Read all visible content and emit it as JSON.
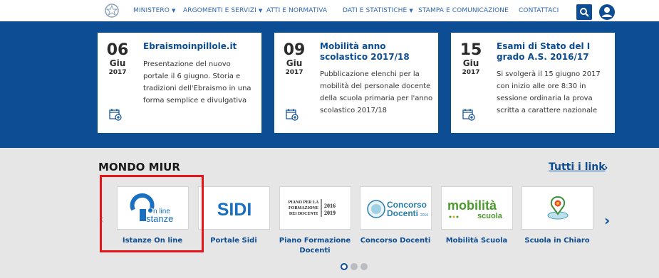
{
  "nav": {
    "items": [
      {
        "label": "MINISTERO",
        "dropdown": true
      },
      {
        "label": "ARGOMENTI E SERVIZI",
        "dropdown": true
      },
      {
        "label": "ATTI E NORMATIVA",
        "dropdown": false
      },
      {
        "label": "DATI E STATISTICHE",
        "dropdown": true
      },
      {
        "label": "STAMPA E COMUNICAZIONE",
        "dropdown": false
      },
      {
        "label": "CONTATTACI",
        "dropdown": false
      }
    ],
    "caret": "▼"
  },
  "news": [
    {
      "day": "06",
      "month": "Giu",
      "year": "2017",
      "title": "Ebraismoinpillole.it",
      "text": "Presentazione del nuovo portale il 6 giugno. Storia e tradizioni dell'Ebraismo in una forma semplice e divulgativa"
    },
    {
      "day": "09",
      "month": "Giu",
      "year": "2017",
      "title": "Mobilità anno scolastico 2017/18",
      "text": "Pubblicazione elenchi per la mobilità del personale docente della scuola primaria per l'anno scolastico 2017/18"
    },
    {
      "day": "15",
      "month": "Giu",
      "year": "2017",
      "title": "Esami di Stato del I grado A.S. 2016/17",
      "text": "Si svolgerà il 15 giugno 2017 con inizio alle ore 8:30 in sessione ordinaria la prova scritta a carattere nazionale"
    }
  ],
  "mondo": {
    "title": "MONDO MIUR",
    "all_links": "Tutti i link",
    "all_links_chevron": "›",
    "prev": "‹",
    "next": "›",
    "tiles": [
      {
        "label": "Istanze On line",
        "logo_line1": "n line",
        "logo_line2": "stanze"
      },
      {
        "label": "Portale Sidi",
        "logo": "SIDI"
      },
      {
        "label": "Piano Formazione Docenti",
        "logo_lines": [
          "PIANO PER LA",
          "FORMAZIONE",
          "DEI DOCENTI"
        ],
        "logo_years": [
          "2016",
          "2019"
        ]
      },
      {
        "label": "Concorso Docenti",
        "logo_line1": "Concorso",
        "logo_line2": "Docenti",
        "logo_year": "2016"
      },
      {
        "label": "Mobilità Scuola",
        "logo_line1": "mobilità",
        "logo_line2": "scuola"
      },
      {
        "label": "Scuola in Chiaro"
      }
    ],
    "pagination": {
      "pages": 3,
      "current": 1
    }
  },
  "colors": {
    "brand_blue": "#0c4d93",
    "highlight_red": "#e5161b",
    "band_background": "#0c4d93"
  }
}
